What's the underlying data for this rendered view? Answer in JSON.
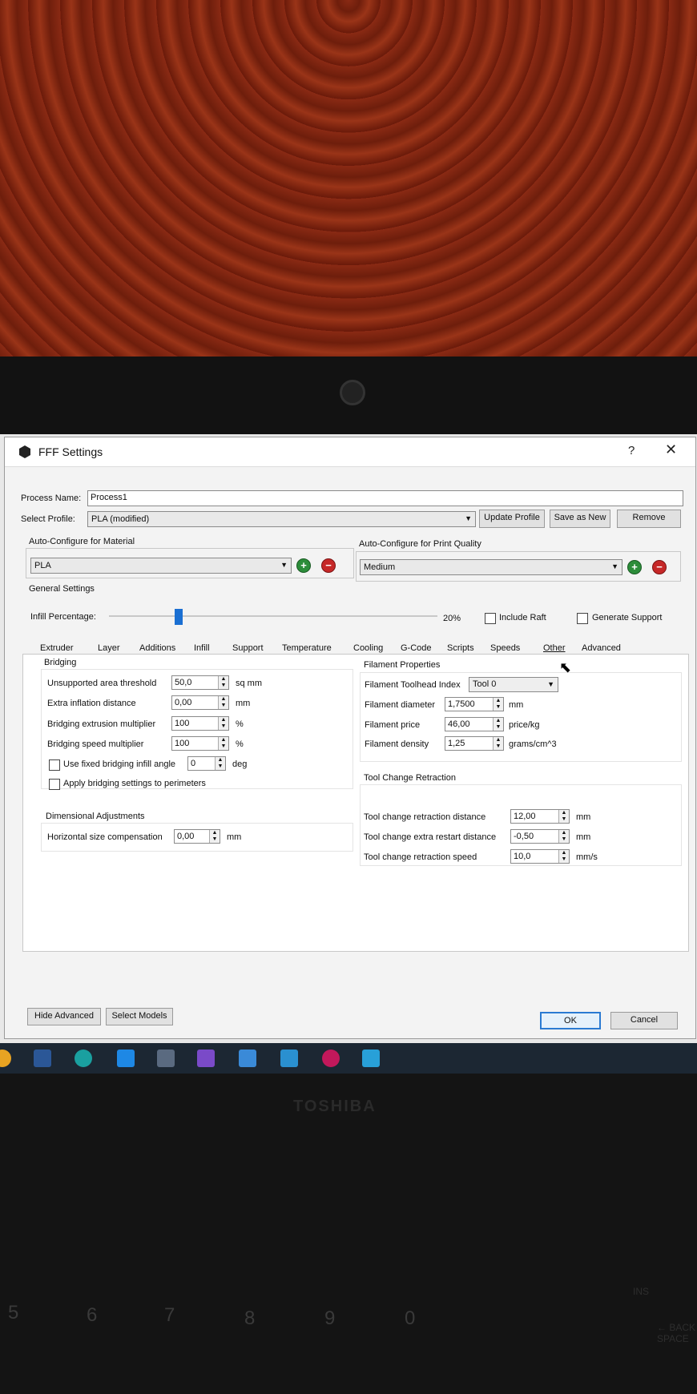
{
  "window": {
    "title": "FFF Settings",
    "help": "?",
    "close": "✕"
  },
  "process": {
    "label": "Process Name:",
    "value": "Process1"
  },
  "profile": {
    "label": "Select Profile:",
    "value": "PLA (modified)",
    "update": "Update Profile",
    "save_new": "Save as New",
    "remove": "Remove"
  },
  "material": {
    "label": "Auto-Configure for Material",
    "value": "PLA"
  },
  "quality": {
    "label": "Auto-Configure for Print Quality",
    "value": "Medium"
  },
  "general": {
    "label": "General Settings",
    "infill_label": "Infill Percentage:",
    "infill_value": "20%",
    "infill_fraction": 0.2,
    "raft": "Include Raft",
    "support": "Generate Support"
  },
  "tabs": [
    "Extruder",
    "Layer",
    "Additions",
    "Infill",
    "Support",
    "Temperature",
    "Cooling",
    "G-Code",
    "Scripts",
    "Speeds",
    "Other",
    "Advanced"
  ],
  "active_tab": "Other",
  "bridging": {
    "header": "Bridging",
    "unsupported_label": "Unsupported area threshold",
    "unsupported_value": "50,0",
    "unsupported_unit": "sq mm",
    "inflation_label": "Extra inflation distance",
    "inflation_value": "0,00",
    "inflation_unit": "mm",
    "extrusion_label": "Bridging extrusion multiplier",
    "extrusion_value": "100",
    "extrusion_unit": "%",
    "speed_label": "Bridging speed multiplier",
    "speed_value": "100",
    "speed_unit": "%",
    "fixed_angle_label": "Use fixed bridging infill angle",
    "fixed_angle_value": "0",
    "fixed_angle_unit": "deg",
    "perimeters_label": "Apply bridging settings to perimeters"
  },
  "dimensional": {
    "header": "Dimensional Adjustments",
    "hsize_label": "Horizontal size compensation",
    "hsize_value": "0,00",
    "hsize_unit": "mm"
  },
  "filament": {
    "header": "Filament Properties",
    "toolhead_label": "Filament Toolhead Index",
    "toolhead_value": "Tool 0",
    "diameter_label": "Filament diameter",
    "diameter_value": "1,7500",
    "diameter_unit": "mm",
    "price_label": "Filament price",
    "price_value": "46,00",
    "price_unit": "price/kg",
    "density_label": "Filament density",
    "density_value": "1,25",
    "density_unit": "grams/cm^3"
  },
  "toolchange": {
    "header": "Tool Change Retraction",
    "distance_label": "Tool change retraction distance",
    "distance_value": "12,00",
    "distance_unit": "mm",
    "restart_label": "Tool change extra restart distance",
    "restart_value": "-0,50",
    "restart_unit": "mm",
    "speed_label": "Tool change retraction speed",
    "speed_value": "10,0",
    "speed_unit": "mm/s"
  },
  "footer": {
    "hide_advanced": "Hide Advanced",
    "select_models": "Select Models",
    "ok": "OK",
    "cancel": "Cancel"
  },
  "laptop": {
    "brand": "TOSHIBA"
  },
  "colors": {
    "accent": "#1a6fd2",
    "add": "#2c8d3a",
    "remove": "#c62828"
  }
}
